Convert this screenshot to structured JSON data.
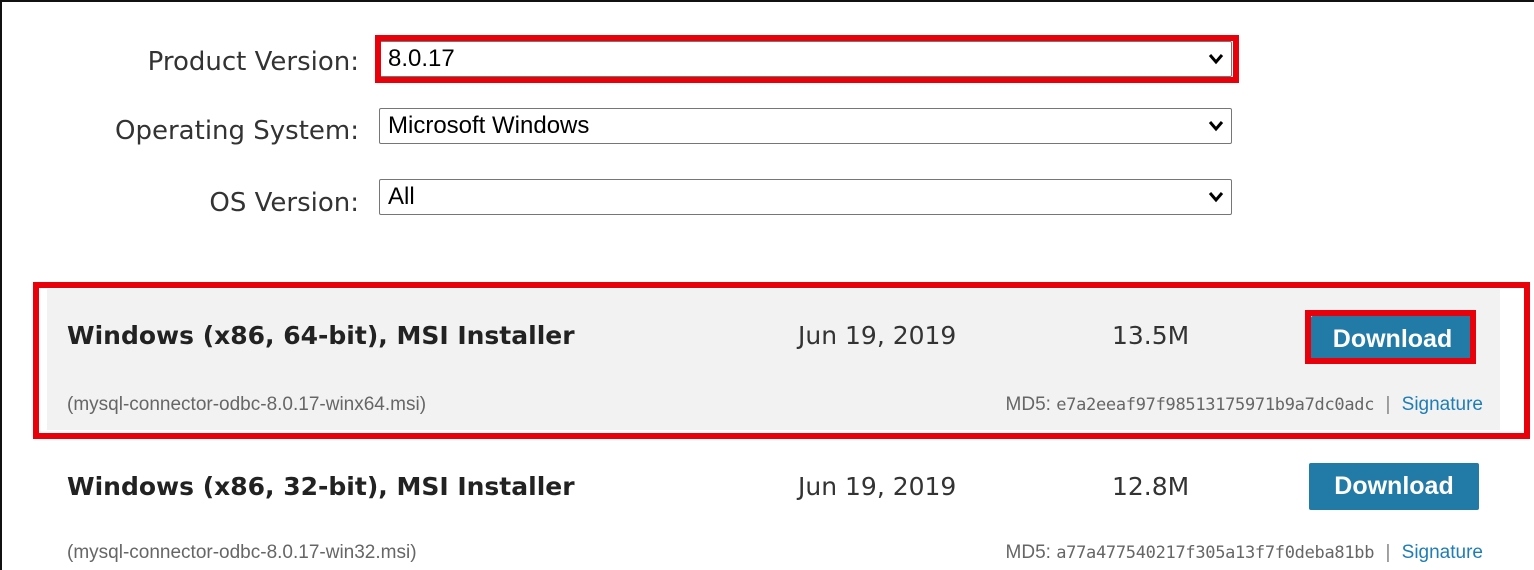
{
  "filters": {
    "product_version": {
      "label": "Product Version:",
      "value": "8.0.17"
    },
    "operating_system": {
      "label": "Operating System:",
      "value": "Microsoft Windows"
    },
    "os_version": {
      "label": "OS Version:",
      "value": "All"
    }
  },
  "downloads": [
    {
      "title": "Windows (x86, 64-bit), MSI Installer",
      "date": "Jun 19, 2019",
      "size": "13.5M",
      "button": "Download",
      "filename": "(mysql-connector-odbc-8.0.17-winx64.msi)",
      "md5_label": "MD5:",
      "md5": "e7a2eeaf97f98513175971b9a7dc0adc",
      "separator": "|",
      "signature": "Signature"
    },
    {
      "title": "Windows (x86, 32-bit), MSI Installer",
      "date": "Jun 19, 2019",
      "size": "12.8M",
      "button": "Download",
      "filename": "(mysql-connector-odbc-8.0.17-win32.msi)",
      "md5_label": "MD5:",
      "md5": "a77a477540217f305a13f7f0deba81bb",
      "separator": "|",
      "signature": "Signature"
    }
  ],
  "colors": {
    "highlight": "#e8000b",
    "button": "#227aa6",
    "link": "#1f7db5",
    "shaded_row": "#f2f2f2"
  },
  "icons": {
    "select_arrow": "chevron-down-icon"
  }
}
